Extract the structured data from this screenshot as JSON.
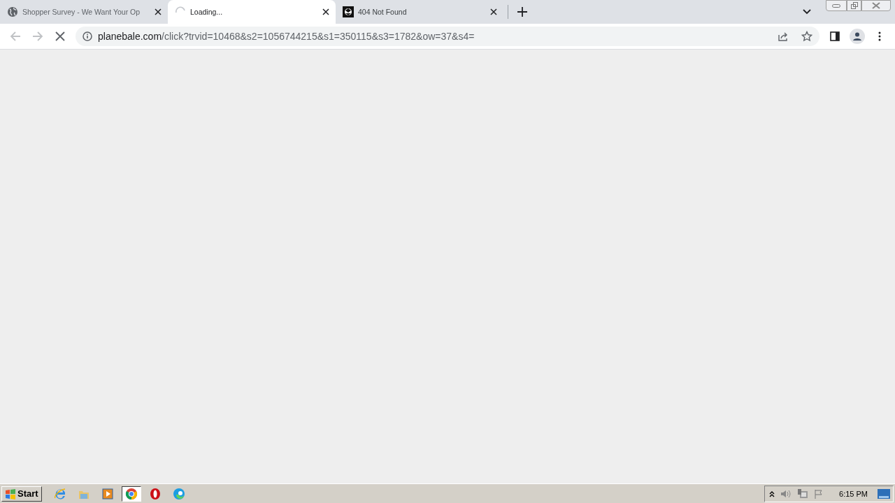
{
  "tabs": [
    {
      "title": "Shopper Survey - We Want Your Op",
      "kind": "globe",
      "selected": false
    },
    {
      "title": "Loading...",
      "kind": "spinner",
      "selected": true
    },
    {
      "title": "404 Not Found",
      "kind": "favicon",
      "selected": false
    }
  ],
  "address": {
    "domain": "planebale.com",
    "path": "/click?trvid=10468&s2=1056744215&s1=350115&s3=1782&ow=37&s4="
  },
  "loading": true,
  "taskbar": {
    "start": "Start",
    "apps": [
      {
        "kind": "ie",
        "selected": false
      },
      {
        "kind": "folder",
        "selected": false
      },
      {
        "kind": "media",
        "selected": false
      },
      {
        "kind": "chrome",
        "selected": true
      },
      {
        "kind": "opera",
        "selected": false
      },
      {
        "kind": "edge",
        "selected": false
      }
    ],
    "clock": "6:15 PM"
  }
}
